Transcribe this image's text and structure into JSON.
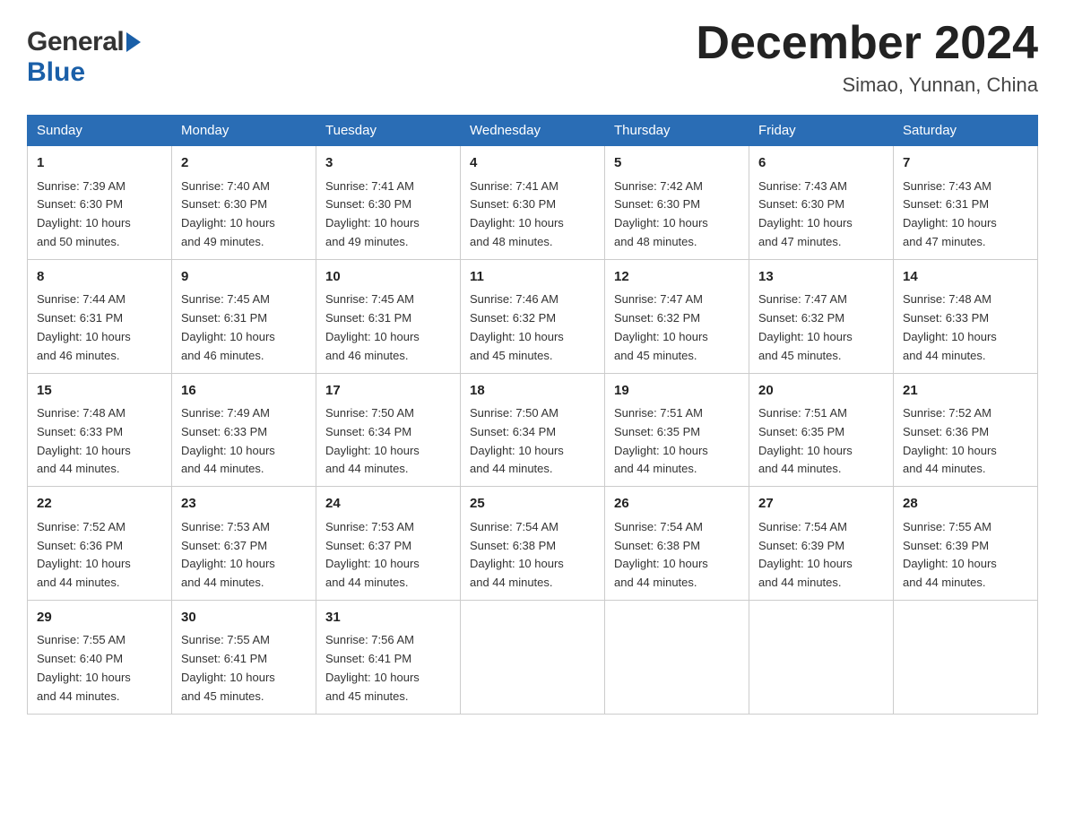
{
  "header": {
    "logo_general": "General",
    "logo_blue": "Blue",
    "month_title": "December 2024",
    "location": "Simao, Yunnan, China"
  },
  "days_of_week": [
    "Sunday",
    "Monday",
    "Tuesday",
    "Wednesday",
    "Thursday",
    "Friday",
    "Saturday"
  ],
  "weeks": [
    [
      {
        "day": "1",
        "sunrise": "7:39 AM",
        "sunset": "6:30 PM",
        "daylight": "10 hours and 50 minutes."
      },
      {
        "day": "2",
        "sunrise": "7:40 AM",
        "sunset": "6:30 PM",
        "daylight": "10 hours and 49 minutes."
      },
      {
        "day": "3",
        "sunrise": "7:41 AM",
        "sunset": "6:30 PM",
        "daylight": "10 hours and 49 minutes."
      },
      {
        "day": "4",
        "sunrise": "7:41 AM",
        "sunset": "6:30 PM",
        "daylight": "10 hours and 48 minutes."
      },
      {
        "day": "5",
        "sunrise": "7:42 AM",
        "sunset": "6:30 PM",
        "daylight": "10 hours and 48 minutes."
      },
      {
        "day": "6",
        "sunrise": "7:43 AM",
        "sunset": "6:30 PM",
        "daylight": "10 hours and 47 minutes."
      },
      {
        "day": "7",
        "sunrise": "7:43 AM",
        "sunset": "6:31 PM",
        "daylight": "10 hours and 47 minutes."
      }
    ],
    [
      {
        "day": "8",
        "sunrise": "7:44 AM",
        "sunset": "6:31 PM",
        "daylight": "10 hours and 46 minutes."
      },
      {
        "day": "9",
        "sunrise": "7:45 AM",
        "sunset": "6:31 PM",
        "daylight": "10 hours and 46 minutes."
      },
      {
        "day": "10",
        "sunrise": "7:45 AM",
        "sunset": "6:31 PM",
        "daylight": "10 hours and 46 minutes."
      },
      {
        "day": "11",
        "sunrise": "7:46 AM",
        "sunset": "6:32 PM",
        "daylight": "10 hours and 45 minutes."
      },
      {
        "day": "12",
        "sunrise": "7:47 AM",
        "sunset": "6:32 PM",
        "daylight": "10 hours and 45 minutes."
      },
      {
        "day": "13",
        "sunrise": "7:47 AM",
        "sunset": "6:32 PM",
        "daylight": "10 hours and 45 minutes."
      },
      {
        "day": "14",
        "sunrise": "7:48 AM",
        "sunset": "6:33 PM",
        "daylight": "10 hours and 44 minutes."
      }
    ],
    [
      {
        "day": "15",
        "sunrise": "7:48 AM",
        "sunset": "6:33 PM",
        "daylight": "10 hours and 44 minutes."
      },
      {
        "day": "16",
        "sunrise": "7:49 AM",
        "sunset": "6:33 PM",
        "daylight": "10 hours and 44 minutes."
      },
      {
        "day": "17",
        "sunrise": "7:50 AM",
        "sunset": "6:34 PM",
        "daylight": "10 hours and 44 minutes."
      },
      {
        "day": "18",
        "sunrise": "7:50 AM",
        "sunset": "6:34 PM",
        "daylight": "10 hours and 44 minutes."
      },
      {
        "day": "19",
        "sunrise": "7:51 AM",
        "sunset": "6:35 PM",
        "daylight": "10 hours and 44 minutes."
      },
      {
        "day": "20",
        "sunrise": "7:51 AM",
        "sunset": "6:35 PM",
        "daylight": "10 hours and 44 minutes."
      },
      {
        "day": "21",
        "sunrise": "7:52 AM",
        "sunset": "6:36 PM",
        "daylight": "10 hours and 44 minutes."
      }
    ],
    [
      {
        "day": "22",
        "sunrise": "7:52 AM",
        "sunset": "6:36 PM",
        "daylight": "10 hours and 44 minutes."
      },
      {
        "day": "23",
        "sunrise": "7:53 AM",
        "sunset": "6:37 PM",
        "daylight": "10 hours and 44 minutes."
      },
      {
        "day": "24",
        "sunrise": "7:53 AM",
        "sunset": "6:37 PM",
        "daylight": "10 hours and 44 minutes."
      },
      {
        "day": "25",
        "sunrise": "7:54 AM",
        "sunset": "6:38 PM",
        "daylight": "10 hours and 44 minutes."
      },
      {
        "day": "26",
        "sunrise": "7:54 AM",
        "sunset": "6:38 PM",
        "daylight": "10 hours and 44 minutes."
      },
      {
        "day": "27",
        "sunrise": "7:54 AM",
        "sunset": "6:39 PM",
        "daylight": "10 hours and 44 minutes."
      },
      {
        "day": "28",
        "sunrise": "7:55 AM",
        "sunset": "6:39 PM",
        "daylight": "10 hours and 44 minutes."
      }
    ],
    [
      {
        "day": "29",
        "sunrise": "7:55 AM",
        "sunset": "6:40 PM",
        "daylight": "10 hours and 44 minutes."
      },
      {
        "day": "30",
        "sunrise": "7:55 AM",
        "sunset": "6:41 PM",
        "daylight": "10 hours and 45 minutes."
      },
      {
        "day": "31",
        "sunrise": "7:56 AM",
        "sunset": "6:41 PM",
        "daylight": "10 hours and 45 minutes."
      },
      null,
      null,
      null,
      null
    ]
  ],
  "labels": {
    "sunrise": "Sunrise:",
    "sunset": "Sunset:",
    "daylight": "Daylight:"
  }
}
